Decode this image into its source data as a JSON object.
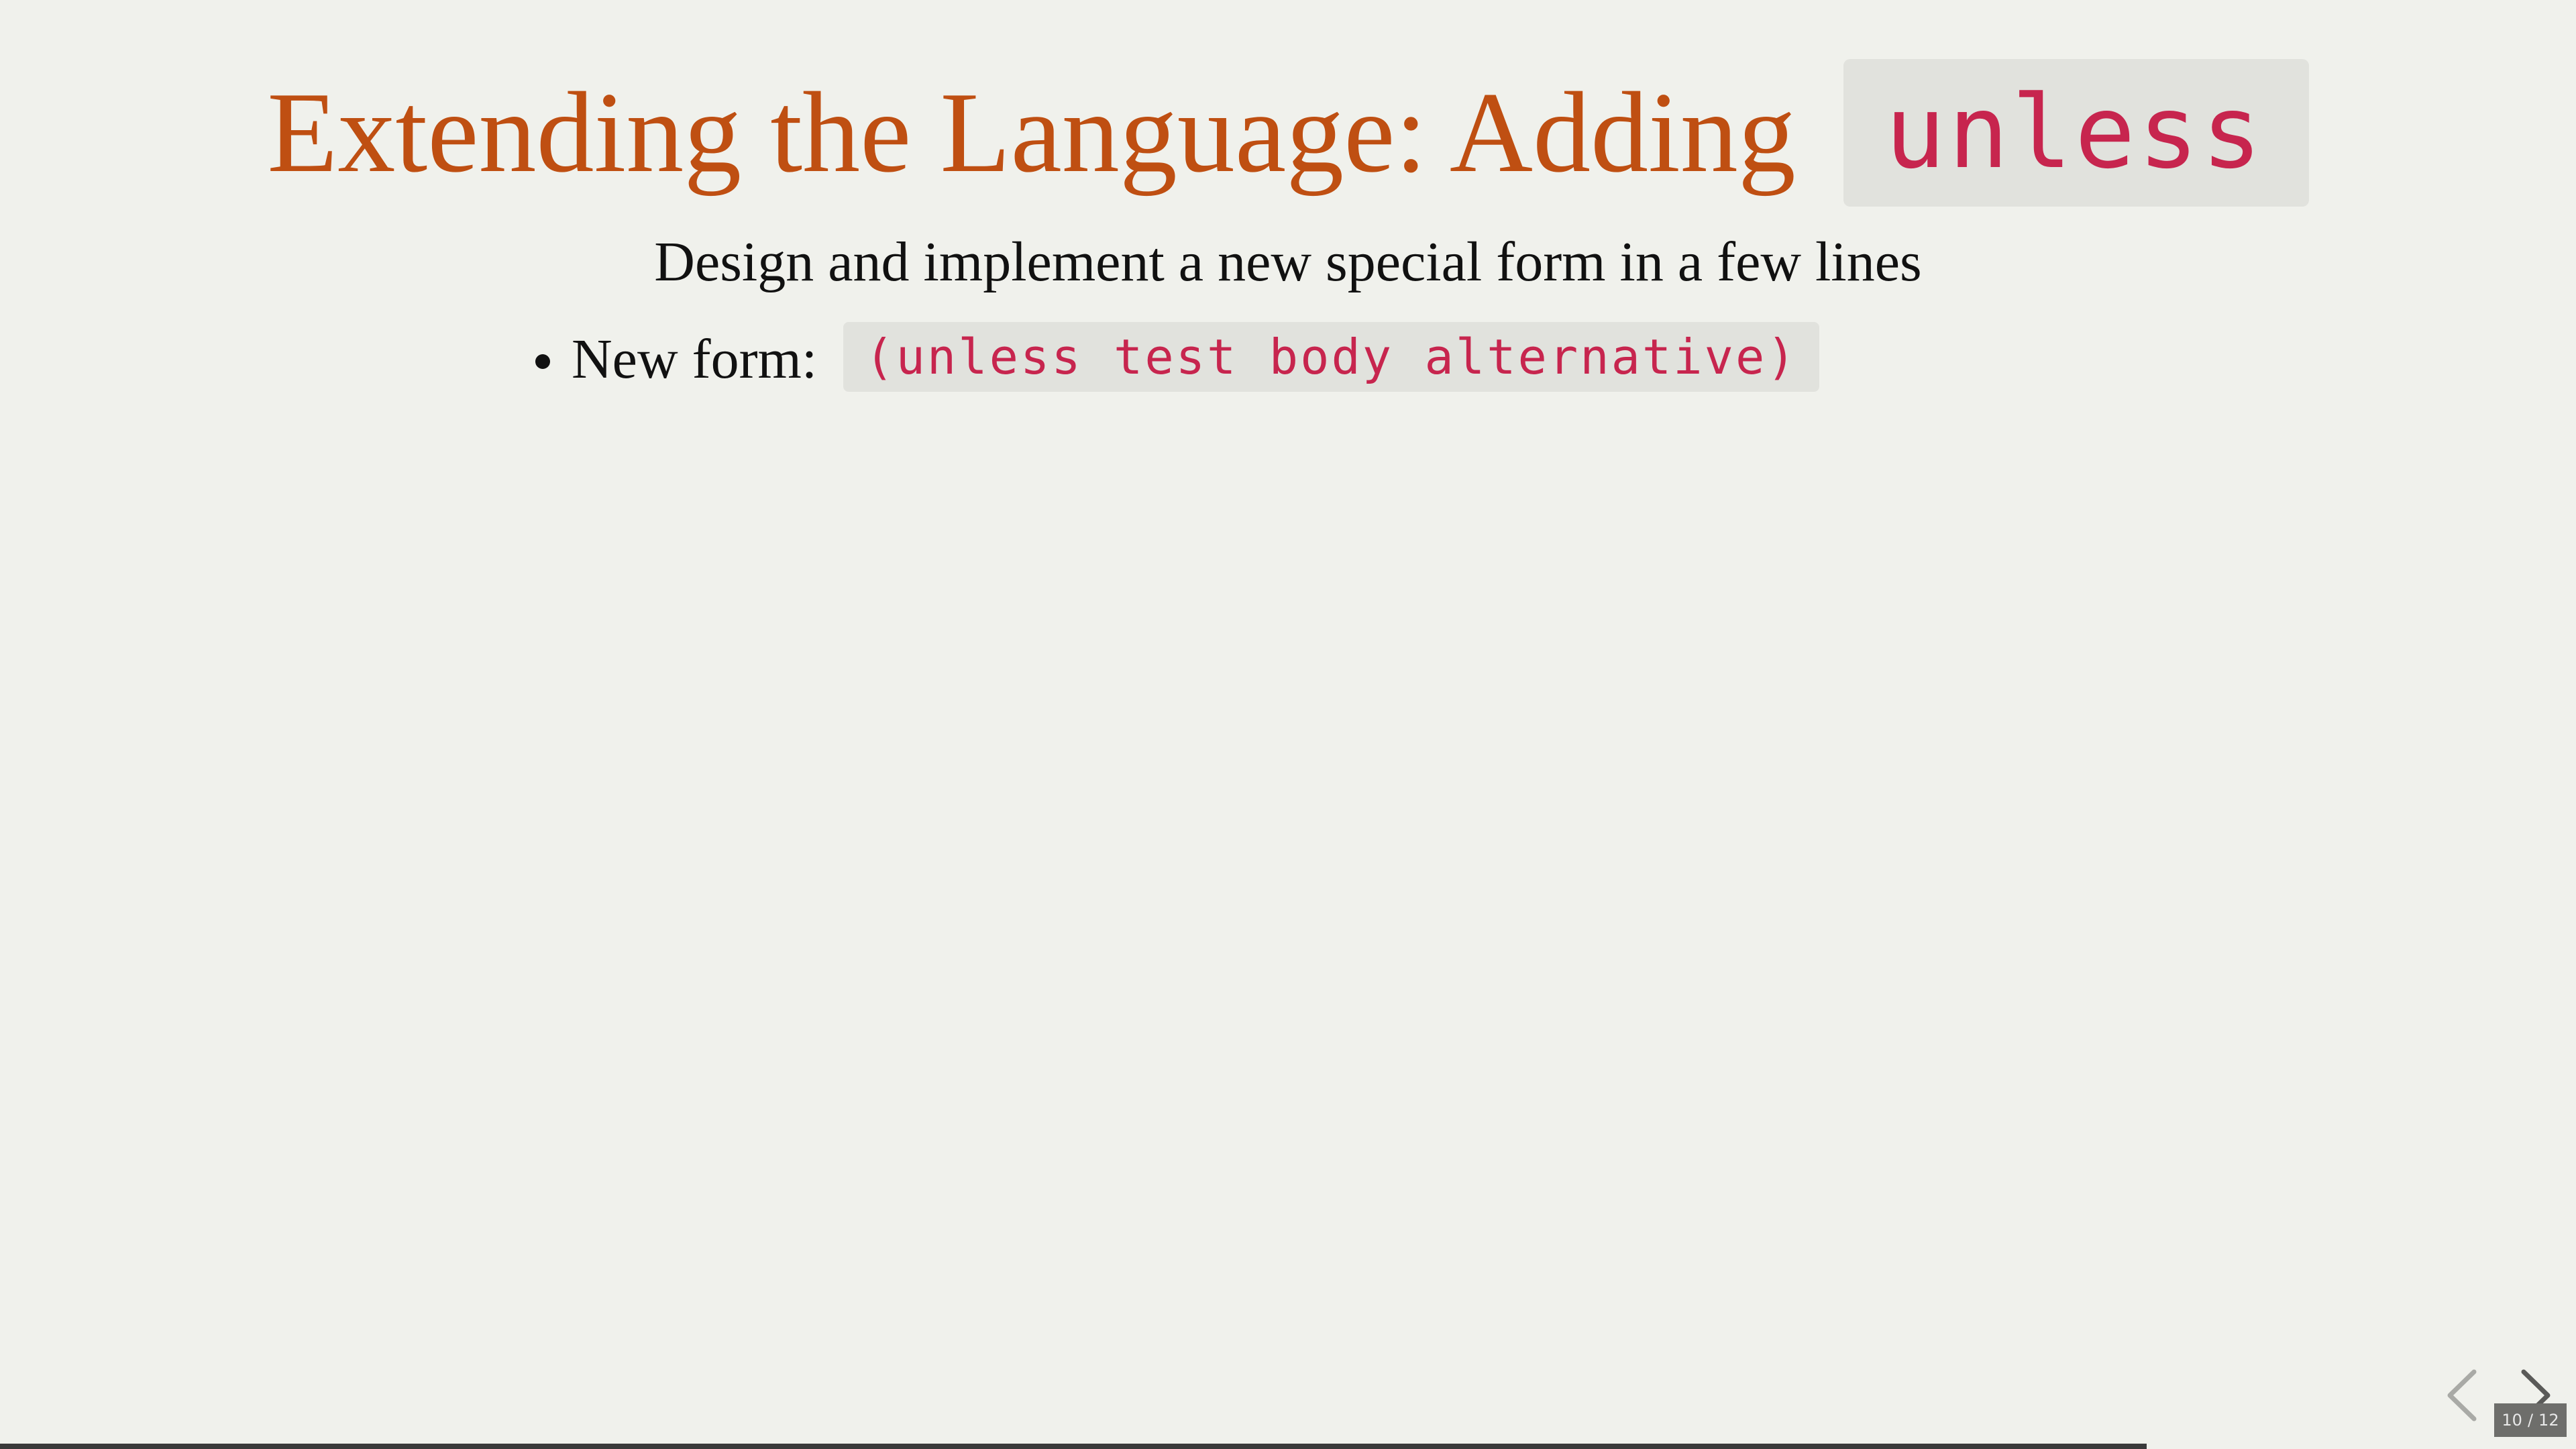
{
  "slide": {
    "title_text": "Extending the Language: Adding",
    "title_code": "unless",
    "subtitle": "Design and implement a new special form in a few lines",
    "bullets": [
      {
        "label": "New form:",
        "code": "(unless test body alternative)"
      }
    ]
  },
  "navigation": {
    "current_page": "10",
    "separator": "/",
    "total_pages": "12",
    "progress_fraction": 0.8333,
    "prev_icon": "chevron-left-icon",
    "next_icon": "chevron-right-icon"
  },
  "colors": {
    "background": "#f0f1ec",
    "title": "#bf4f12",
    "code_text": "#c7254e",
    "code_background": "#e1e2dd",
    "body_text": "#111111",
    "progress": "#3a3a3a"
  }
}
